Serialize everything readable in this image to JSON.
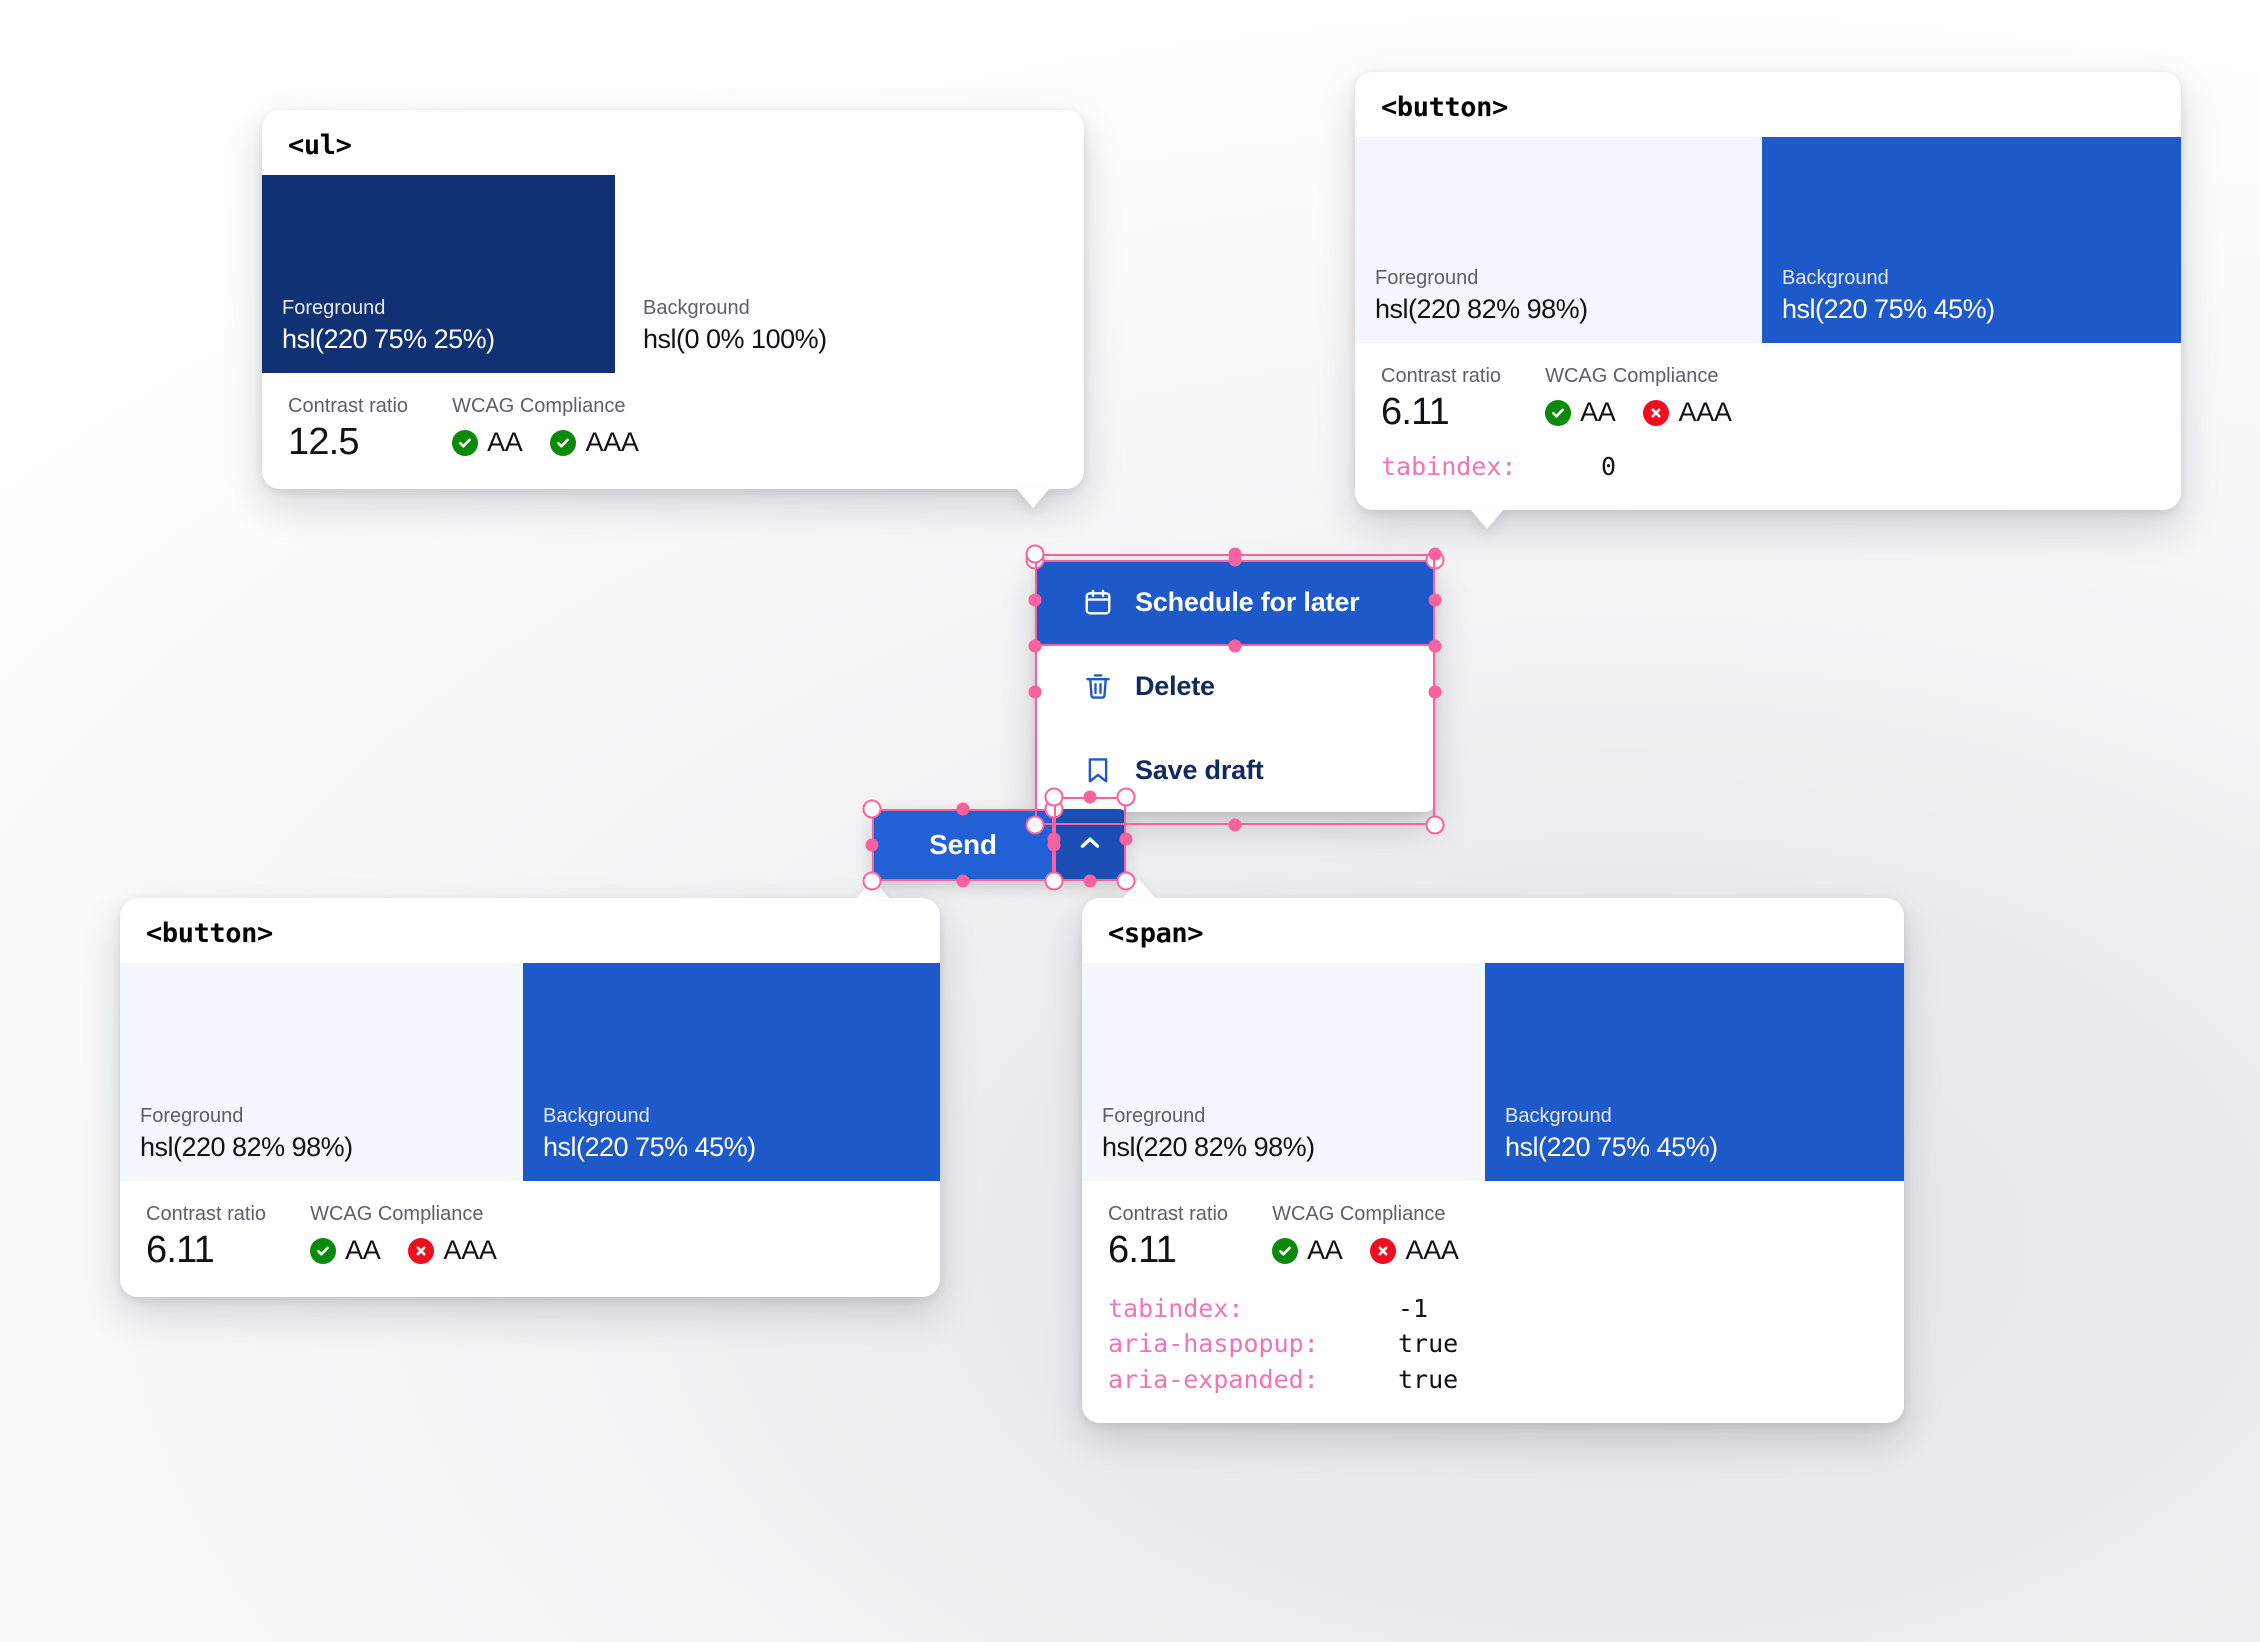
{
  "theme": {
    "accent_blue": "#1d59c9",
    "dark_navy": "#103173",
    "light_surface": "#f5f7fe",
    "pass_green": "#0a8a0a",
    "fail_red": "#f00d1e",
    "selection_pink": "#f9619f",
    "attr_key_pink": "#f472b6"
  },
  "labels": {
    "foreground": "Foreground",
    "background": "Background",
    "contrast_ratio": "Contrast ratio",
    "wcag_compliance": "WCAG Compliance",
    "aa": "AA",
    "aaa": "AAA"
  },
  "cards": [
    {
      "tag": "<ul>",
      "foreground_label": "Foreground",
      "foreground_value": "hsl(220 75% 25%)",
      "foreground_color": "#103173",
      "background_label": "Background",
      "background_value": "hsl(0 0% 100%)",
      "background_color": "#ffffff",
      "contrast_label": "Contrast ratio",
      "contrast_value": "12.5",
      "wcag_label": "WCAG Compliance",
      "aa": {
        "label": "AA",
        "status": "pass",
        "icon": "check-circle-icon"
      },
      "aaa": {
        "label": "AAA",
        "status": "pass",
        "icon": "check-circle-icon"
      },
      "attributes": []
    },
    {
      "tag": "<button>",
      "foreground_label": "Foreground",
      "foreground_value": "hsl(220 82% 98%)",
      "foreground_color": "#f5f7fe",
      "background_label": "Background",
      "background_value": "hsl(220 75% 45%)",
      "background_color": "#1d59c9",
      "contrast_label": "Contrast ratio",
      "contrast_value": "6.11",
      "wcag_label": "WCAG Compliance",
      "aa": {
        "label": "AA",
        "status": "pass",
        "icon": "check-circle-icon"
      },
      "aaa": {
        "label": "AAA",
        "status": "fail",
        "icon": "x-circle-icon"
      },
      "attributes": [
        {
          "key": "tabindex:",
          "value": "0"
        }
      ]
    },
    {
      "tag": "<button>",
      "foreground_label": "Foreground",
      "foreground_value": "hsl(220 82% 98%)",
      "foreground_color": "#f5f7fe",
      "background_label": "Background",
      "background_value": "hsl(220 75% 45%)",
      "background_color": "#1d59c9",
      "contrast_label": "Contrast ratio",
      "contrast_value": "6.11",
      "wcag_label": "WCAG Compliance",
      "aa": {
        "label": "AA",
        "status": "pass",
        "icon": "check-circle-icon"
      },
      "aaa": {
        "label": "AAA",
        "status": "fail",
        "icon": "x-circle-icon"
      },
      "attributes": []
    },
    {
      "tag": "<span>",
      "foreground_label": "Foreground",
      "foreground_value": "hsl(220 82% 98%)",
      "foreground_color": "#f5f7fe",
      "background_label": "Background",
      "background_value": "hsl(220 75% 45%)",
      "background_color": "#1d59c9",
      "contrast_label": "Contrast ratio",
      "contrast_value": "6.11",
      "wcag_label": "WCAG Compliance",
      "aa": {
        "label": "AA",
        "status": "pass",
        "icon": "check-circle-icon"
      },
      "aaa": {
        "label": "AAA",
        "status": "fail",
        "icon": "x-circle-icon"
      },
      "attributes": [
        {
          "key": "tabindex:",
          "value": "-1"
        },
        {
          "key": "aria-haspopup:",
          "value": "true"
        },
        {
          "key": "aria-expanded:",
          "value": "true"
        }
      ]
    }
  ],
  "menu": {
    "items": [
      {
        "label": "Schedule for later",
        "icon": "calendar-icon",
        "selected": true
      },
      {
        "label": "Delete",
        "icon": "trash-icon",
        "selected": false
      },
      {
        "label": "Save draft",
        "icon": "bookmark-icon",
        "selected": false
      }
    ]
  },
  "send_button": {
    "label": "Send",
    "toggle_icon": "chevron-up-icon"
  }
}
